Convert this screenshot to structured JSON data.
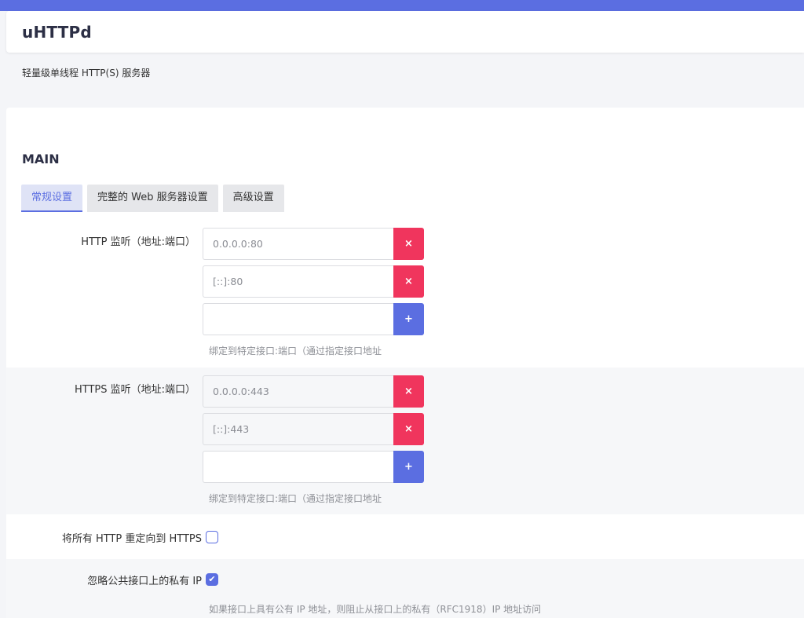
{
  "app": {
    "title": "uHTTPd",
    "description": "轻量级单线程 HTTP(S) 服务器"
  },
  "section": {
    "title": "MAIN"
  },
  "tabs": [
    {
      "label": "常规设置",
      "active": true
    },
    {
      "label": "完整的 Web 服务器设置",
      "active": false
    },
    {
      "label": "高级设置",
      "active": false
    }
  ],
  "http_listen": {
    "label": "HTTP 监听（地址:端口）",
    "entries": [
      "0.0.0.0:80",
      "[::]:80"
    ],
    "new_value": "",
    "hint": "绑定到特定接口:端口（通过指定接口地址"
  },
  "https_listen": {
    "label": "HTTPS 监听（地址:端口）",
    "entries": [
      "0.0.0.0:443",
      "[::]:443"
    ],
    "new_value": "",
    "hint": "绑定到特定接口:端口（通过指定接口地址"
  },
  "redirect_https": {
    "label": "将所有 HTTP 重定向到 HTTPS",
    "checked": false
  },
  "ignore_private": {
    "label": "忽略公共接口上的私有 IP",
    "checked": true,
    "hint": "如果接口上具有公有 IP 地址，则阻止从接口上的私有（RFC1918）IP 地址访问"
  },
  "buttons": {
    "remove_glyph": "×",
    "add_glyph": "+",
    "check_glyph": "✔"
  },
  "colors": {
    "accent": "#5b6ee1",
    "danger": "#f0355d"
  }
}
